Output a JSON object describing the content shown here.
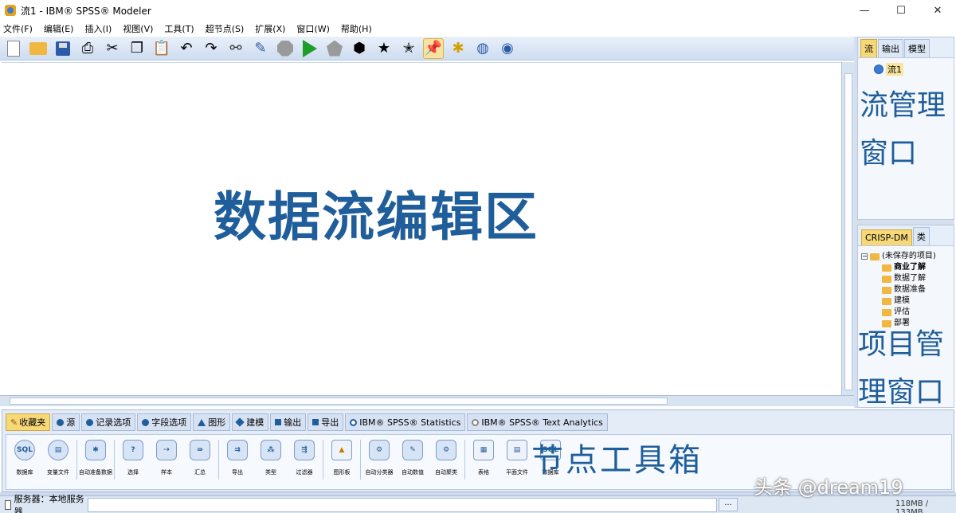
{
  "window": {
    "title": "流1 - IBM® SPSS® Modeler",
    "controls": {
      "minimize": "—",
      "maximize": "☐",
      "close": "✕"
    }
  },
  "menu": [
    "文件(F)",
    "编辑(E)",
    "插入(I)",
    "视图(V)",
    "工具(T)",
    "超节点(S)",
    "扩展(X)",
    "窗口(W)",
    "帮助(H)"
  ],
  "toolbar": {
    "buttons": [
      "new-stream",
      "open-stream",
      "save-stream",
      "print",
      "cut",
      "copy",
      "paste",
      "undo",
      "redo",
      "find",
      "edit",
      "stop",
      "run",
      "run-selection",
      "preview",
      "add-star",
      "pin",
      "new-note",
      "annotate",
      "spelling"
    ]
  },
  "canvas": {
    "label": "数据流编辑区"
  },
  "stream_panel": {
    "tabs": [
      "流",
      "输出",
      "模型"
    ],
    "active_tab": "流",
    "stream_item": "流1",
    "label": "流管理窗口"
  },
  "project_panel": {
    "tabs": [
      "CRISP-DM",
      "类"
    ],
    "active_tab": "CRISP-DM",
    "root": "(未保存的项目)",
    "folders": [
      "商业了解",
      "数据了解",
      "数据准备",
      "建模",
      "评估",
      "部署"
    ],
    "label": "项目管理窗口"
  },
  "palette": {
    "tabs": [
      "收藏夹",
      "源",
      "记录选项",
      "字段选项",
      "图形",
      "建模",
      "输出",
      "导出",
      "IBM® SPSS® Statistics",
      "IBM® SPSS® Text Analytics"
    ],
    "active_tab": "收藏夹",
    "nodes": [
      "数据库",
      "变量文件",
      "自动准备数据",
      "选择",
      "样本",
      "汇总",
      "导出",
      "类型",
      "过滤器",
      "图形板",
      "自动分类器",
      "自动数值",
      "自动聚类",
      "表格",
      "平面文件",
      "数据库"
    ],
    "label": "节点工具箱"
  },
  "status": {
    "server": "服务器：本地服务器",
    "dots": "...",
    "memory": "118MB / 133MB"
  },
  "watermark": "头条 @dream19",
  "colors": {
    "accent": "#1f5e9a",
    "tab_active": "#f6d879",
    "run_green": "#1e9e2a"
  }
}
